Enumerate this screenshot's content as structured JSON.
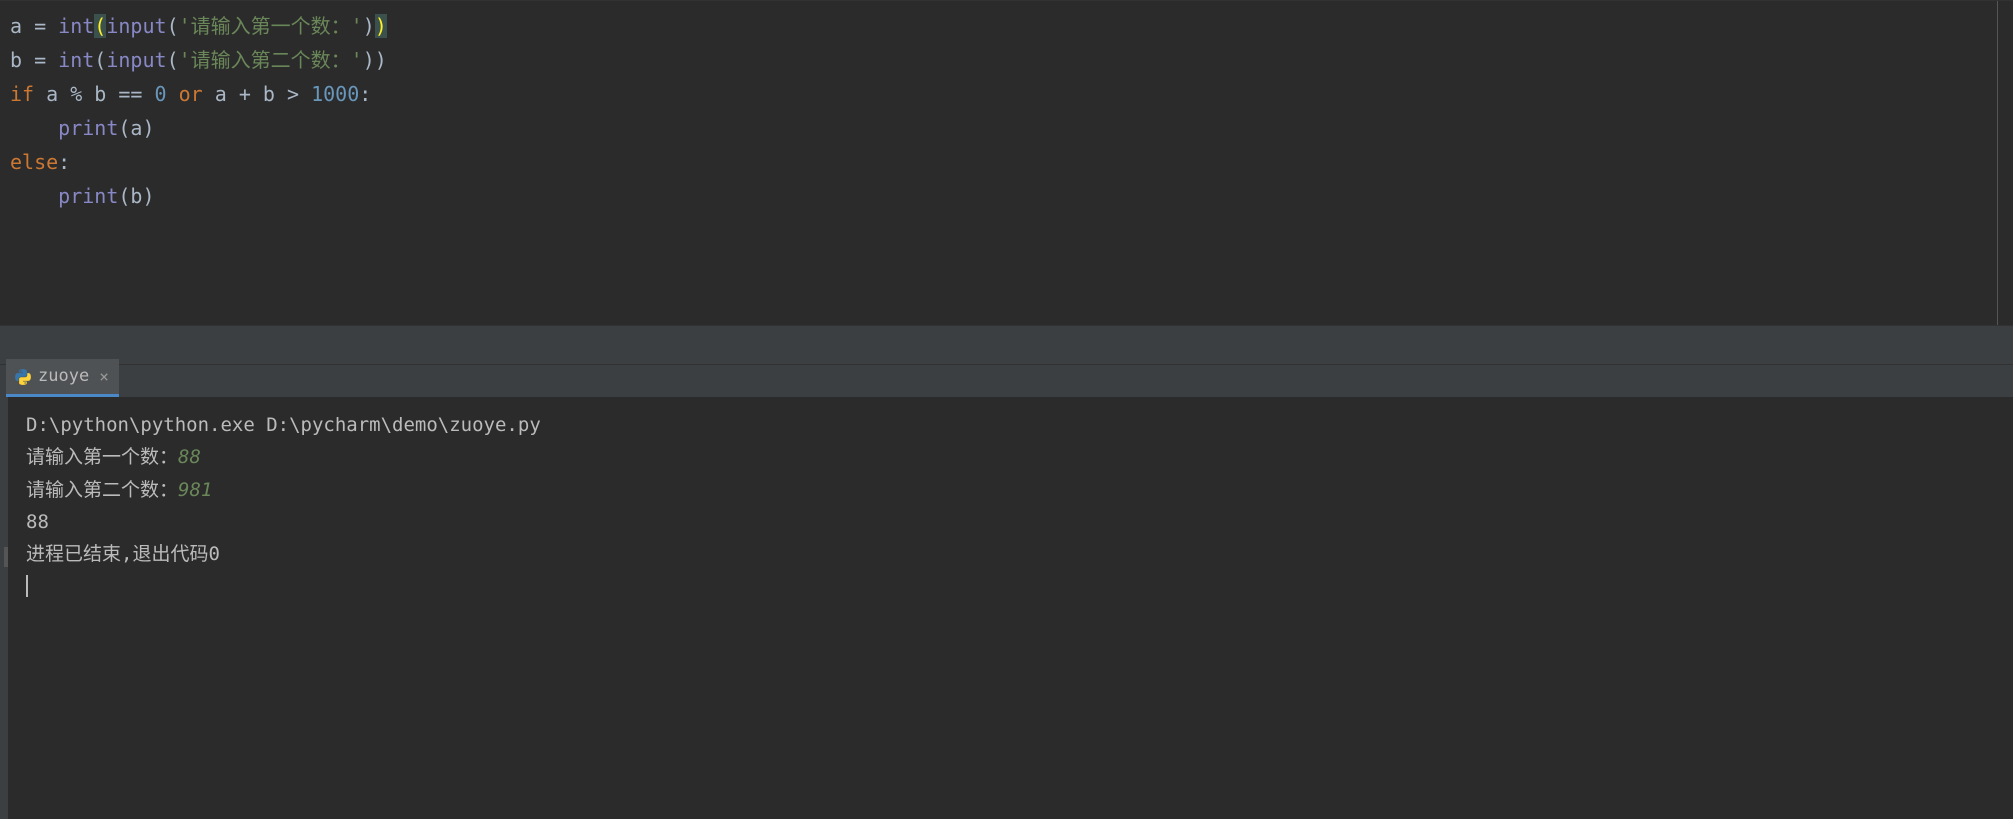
{
  "editor": {
    "code": {
      "l1_a": "a",
      "l1_eq": " = ",
      "l1_int": "int",
      "l1_p1": "(",
      "l1_input": "input",
      "l1_p2": "(",
      "l1_str": "'请输入第一个数：'",
      "l1_p3": ")",
      "l1_p4": ")",
      "l2_a": "b",
      "l2_eq": " = ",
      "l2_int": "int",
      "l2_p1": "(",
      "l2_input": "input",
      "l2_p2": "(",
      "l2_str": "'请输入第二个数：'",
      "l2_p3": ")",
      "l2_p4": ")",
      "l3_if": "if",
      "l3_expr1": " a % b == ",
      "l3_zero": "0",
      "l3_sp1": " ",
      "l3_or": "or",
      "l3_expr2": " a + b > ",
      "l3_thou": "1000",
      "l3_colon": ":",
      "l4_indent": "    ",
      "l4_print": "print",
      "l4_rest": "(a)",
      "l5_else": "else",
      "l5_colon": ":",
      "l6_indent": "    ",
      "l6_print": "print",
      "l6_rest": "(b)"
    }
  },
  "run_tab": {
    "name": "zuoye"
  },
  "console": {
    "cmd": "D:\\python\\python.exe D:\\pycharm\\demo\\zuoye.py",
    "prompt1": "请输入第一个数：",
    "input1": "88",
    "prompt2": "请输入第二个数：",
    "input2": "981",
    "output": "88",
    "blank": "",
    "exit_msg": "进程已结束,退出代码0"
  }
}
